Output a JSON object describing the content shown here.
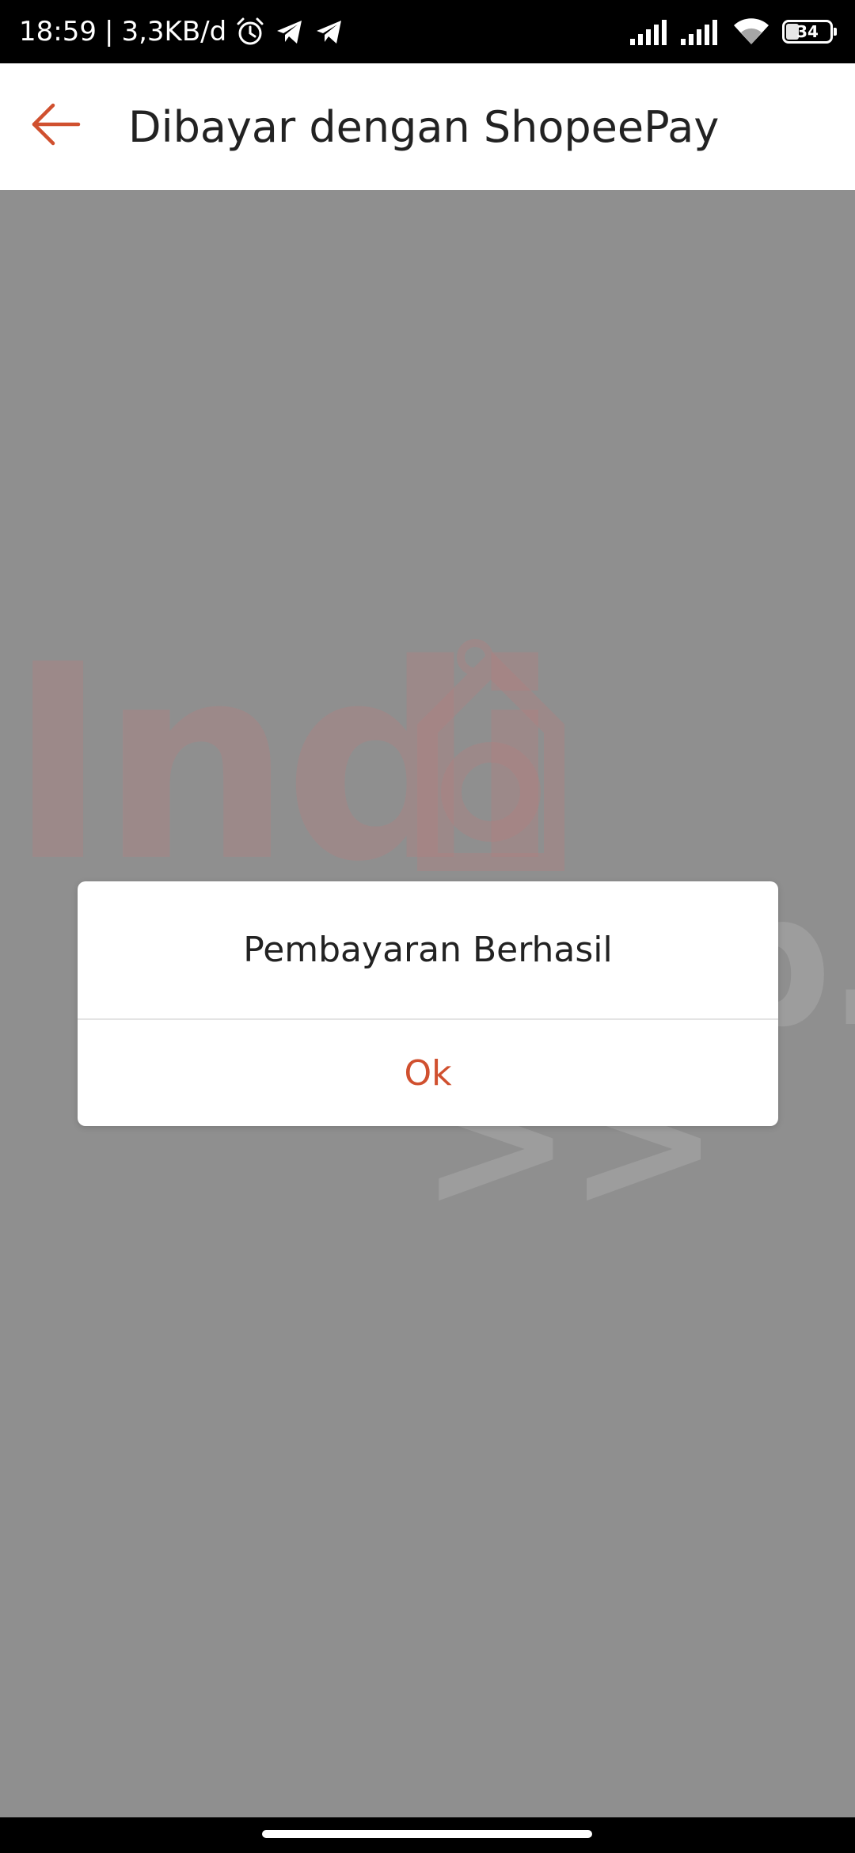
{
  "status_bar": {
    "time": "18:59",
    "separator": "|",
    "network_speed": "3,3KB/d",
    "battery_level": "34",
    "icons": [
      "alarm-icon",
      "telegram-icon",
      "telegram-icon",
      "signal-icon",
      "signal-icon",
      "wifi-icon",
      "battery-icon"
    ]
  },
  "app_bar": {
    "back_icon": "arrow-left-icon",
    "title": "Dibayar dengan ShopeePay"
  },
  "watermark": {
    "text_1": "Indi",
    "text_2": "web.id >>"
  },
  "dialog": {
    "title": "Pembayaran Berhasil",
    "ok_label": "Ok"
  },
  "colors": {
    "accent": "#D0502F",
    "overlay": "#8F8F8F",
    "status_bar": "#000000",
    "app_bar": "#FFFFFF"
  }
}
